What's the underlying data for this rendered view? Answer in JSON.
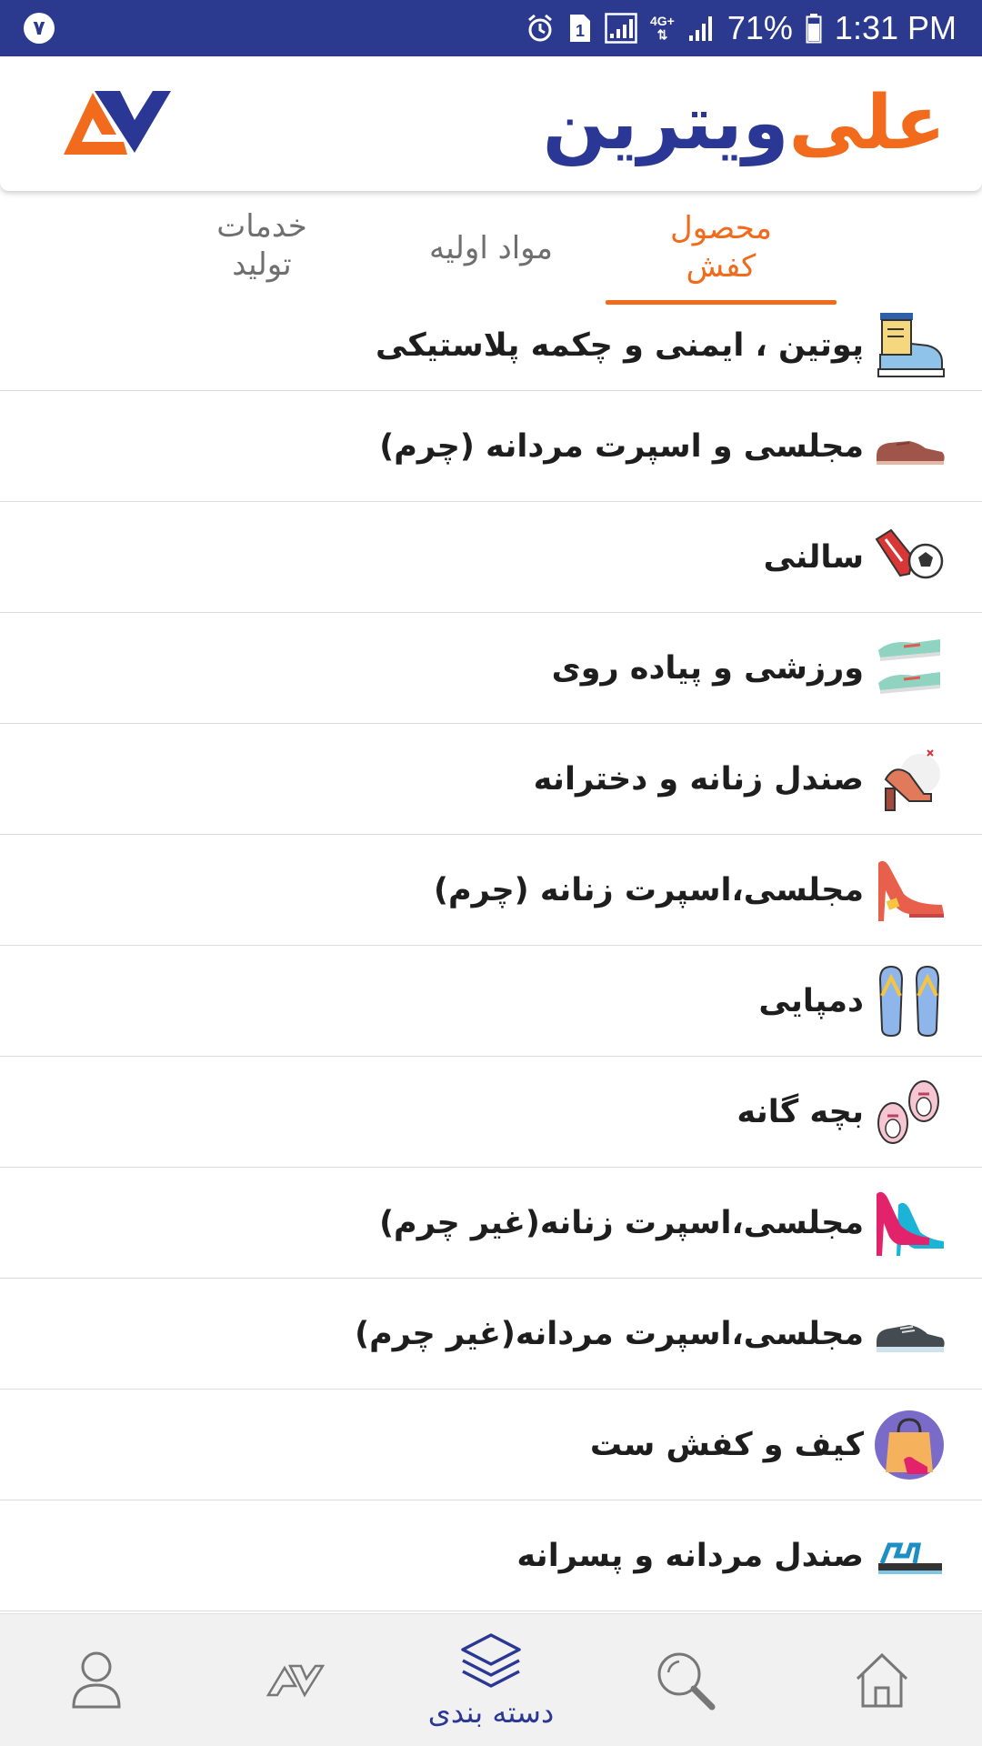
{
  "status_bar": {
    "badge": "۷",
    "sim": "1",
    "network": "4G+",
    "battery": "71%",
    "time": "1:31 PM"
  },
  "header": {
    "brand_part1": "علی",
    "brand_part2": "ویترین"
  },
  "tabs": [
    {
      "label": "محصول کفش",
      "active": true
    },
    {
      "label": "مواد اولیه",
      "active": false
    },
    {
      "label": "خدمات تولید",
      "active": false
    }
  ],
  "categories": [
    {
      "label": "پوتین ، ایمنی و چکمه پلاستیکی",
      "icon": "boot-icon"
    },
    {
      "label": "مجلسی و اسپرت مردانه (چرم)",
      "icon": "mens-leather-shoe-icon"
    },
    {
      "label": "سالنی",
      "icon": "futsal-shoe-icon"
    },
    {
      "label": "ورزشی و پیاده روی",
      "icon": "sneakers-icon"
    },
    {
      "label": "صندل زنانه و دخترانه",
      "icon": "womens-sandal-icon"
    },
    {
      "label": "مجلسی،اسپرت زنانه (چرم)",
      "icon": "high-heel-icon"
    },
    {
      "label": "دمپایی",
      "icon": "flip-flops-icon"
    },
    {
      "label": "بچه گانه",
      "icon": "baby-shoes-icon"
    },
    {
      "label": "مجلسی،اسپرت زنانه(غیر چرم)",
      "icon": "heels-pair-icon"
    },
    {
      "label": "مجلسی،اسپرت مردانه(غیر چرم)",
      "icon": "mens-sneaker-icon"
    },
    {
      "label": "کیف و کفش ست",
      "icon": "bag-shoe-set-icon"
    },
    {
      "label": "صندل مردانه و پسرانه",
      "icon": "mens-sandal-icon"
    }
  ],
  "bottom_nav": {
    "categories_label": "دسته بندی"
  },
  "colors": {
    "primary": "#2a3794",
    "accent": "#f26a1b",
    "status_bar": "#2b3a8f"
  }
}
